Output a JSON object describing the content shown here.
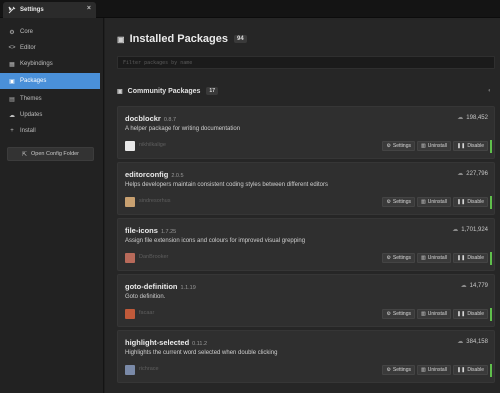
{
  "tab": {
    "title": "Settings",
    "close": "×"
  },
  "sidebar": {
    "items": [
      {
        "label": "Core",
        "icon": "gear"
      },
      {
        "label": "Editor",
        "icon": "code"
      },
      {
        "label": "Keybindings",
        "icon": "keyboard"
      },
      {
        "label": "Packages",
        "icon": "package",
        "active": true
      },
      {
        "label": "Themes",
        "icon": "paintcan"
      },
      {
        "label": "Updates",
        "icon": "cloud-download"
      },
      {
        "label": "Install",
        "icon": "plus"
      }
    ],
    "config_button": "Open Config Folder"
  },
  "installed": {
    "title": "Installed Packages",
    "count": "94",
    "filter_placeholder": "Filter packages by name"
  },
  "community": {
    "title": "Community Packages",
    "count": "17"
  },
  "buttons": {
    "settings": "Settings",
    "uninstall": "Uninstall",
    "disable": "Disable"
  },
  "packages": [
    {
      "name": "docblockr",
      "version": "0.8.7",
      "description": "A helper package for writing documentation",
      "author": "nikhilkalige",
      "downloads": "198,452",
      "avatar_color": "#e8e8e8"
    },
    {
      "name": "editorconfig",
      "version": "2.0.5",
      "description": "Helps developers maintain consistent coding styles between different editors",
      "author": "sindresorhus",
      "downloads": "227,796",
      "avatar_color": "#c8a070"
    },
    {
      "name": "file-icons",
      "version": "1.7.25",
      "description": "Assign file extension icons and colours for improved visual grepping",
      "author": "DanBrooker",
      "downloads": "1,701,924",
      "avatar_color": "#b86a5a"
    },
    {
      "name": "goto-definition",
      "version": "1.1.19",
      "description": "Goto definition.",
      "author": "facaar",
      "downloads": "14,779",
      "avatar_color": "#c05a3a"
    },
    {
      "name": "highlight-selected",
      "version": "0.11.2",
      "description": "Highlights the current word selected when double clicking",
      "author": "richrace",
      "downloads": "384,158",
      "avatar_color": "#7a8aa8"
    }
  ]
}
